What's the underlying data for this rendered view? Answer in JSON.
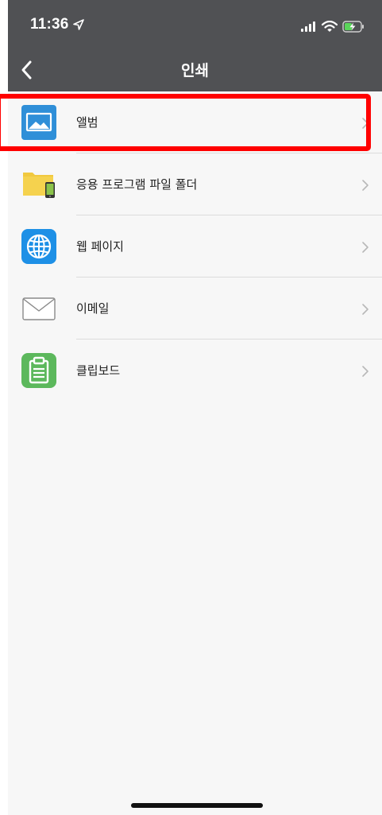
{
  "status_bar": {
    "time": "11:36",
    "icons": [
      "location-arrow-icon",
      "signal-icon",
      "wifi-icon",
      "battery-charging-icon"
    ]
  },
  "nav": {
    "title": "인쇄",
    "back_icon": "chevron-left-icon"
  },
  "list": {
    "items": [
      {
        "label": "앨범",
        "icon": "photo-album-icon",
        "highlighted": true
      },
      {
        "label": "응용 프로그램 파일 폴더",
        "icon": "folder-device-icon"
      },
      {
        "label": "웹 페이지",
        "icon": "globe-icon"
      },
      {
        "label": "이메일",
        "icon": "envelope-icon"
      },
      {
        "label": "클립보드",
        "icon": "clipboard-icon"
      }
    ]
  },
  "colors": {
    "header_bg": "#505154",
    "list_bg": "#f7f7f7",
    "highlight": "#ff0000",
    "album_blue": "#2f8fd8",
    "globe_blue": "#1e90e6",
    "folder_yellow": "#f1c93f",
    "clipboard_green": "#5cb85c"
  }
}
